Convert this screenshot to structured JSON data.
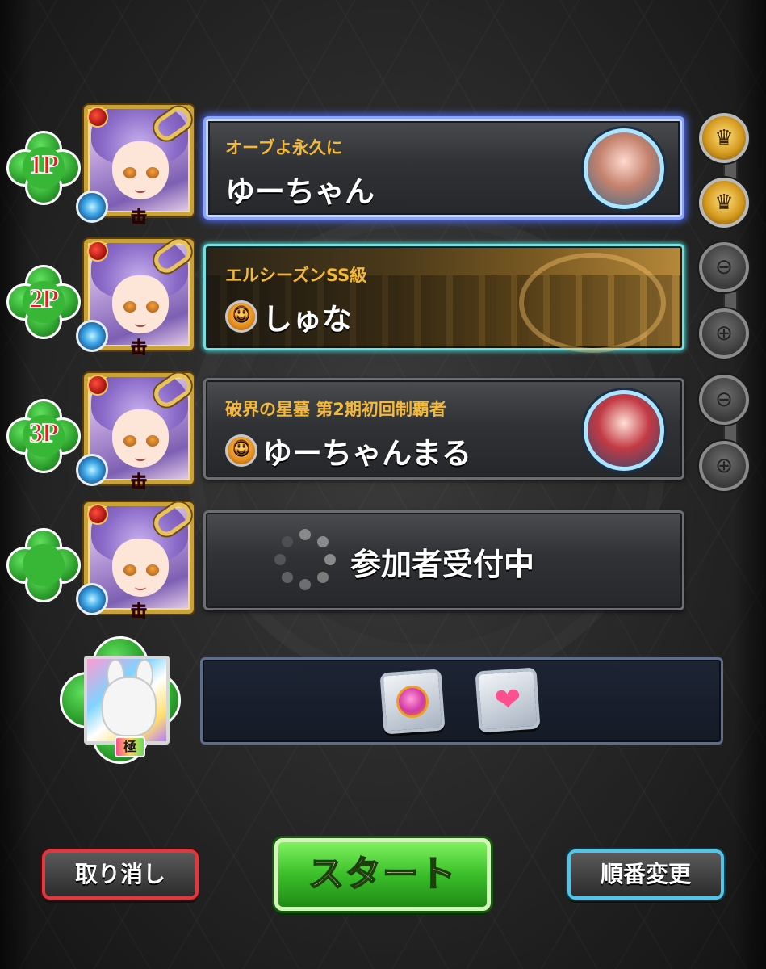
{
  "players": [
    {
      "slot_label": "1P",
      "title": "オーブよ永久に",
      "name": "ゆーちゃん",
      "group_icon": false,
      "avatar": true
    },
    {
      "slot_label": "2P",
      "title": "エルシーズンSS級",
      "name": "しゅな",
      "group_icon": true,
      "avatar": false
    },
    {
      "slot_label": "3P",
      "title": "破界の星墓 第2期初回制覇者",
      "name": "ゆーちゃんまる",
      "group_icon": true,
      "avatar": true
    }
  ],
  "waiting_slot": {
    "status_text": "参加者受付中"
  },
  "helper": {
    "tier_badge": "極",
    "items": [
      "orb-boost-icon",
      "heal-heart-icon"
    ]
  },
  "side_icons": [
    "crown-plus-icon",
    "crown-plus-icon",
    "locked-slot-icon",
    "locked-slot-icon",
    "locked-slot-icon",
    "locked-slot-icon"
  ],
  "buttons": {
    "cancel_label": "取り消し",
    "start_label": "スタート",
    "order_label": "順番変更"
  },
  "colors": {
    "title_gold": "#f4b938",
    "start_green": "#3bbf2a",
    "cancel_red": "#e13840",
    "order_blue": "#52c4e6",
    "player_label_red": "#e41e1e"
  }
}
